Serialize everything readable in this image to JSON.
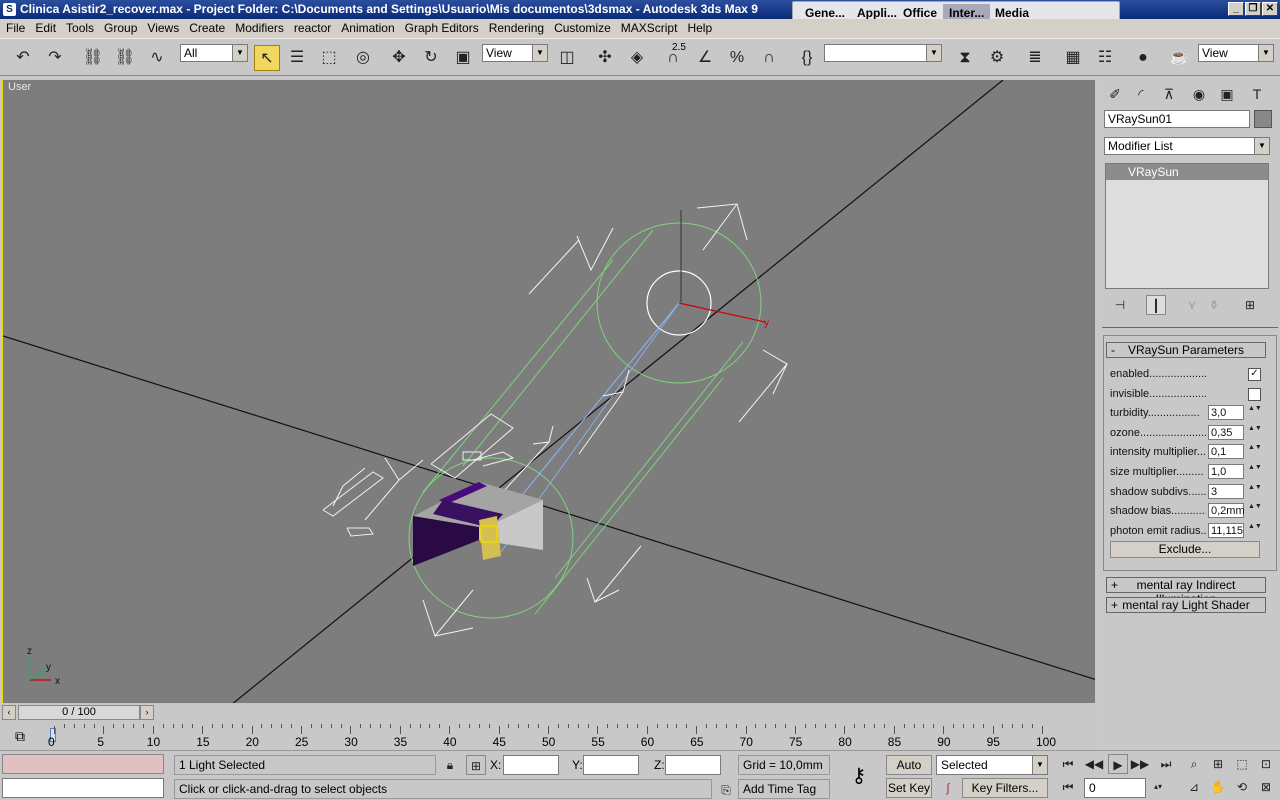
{
  "window": {
    "title": "Clinica Asistir2_recover.max    - Project Folder: C:\\Documents and Settings\\Usuario\\Mis documentos\\3dsmax    - Autodesk 3ds Max 9",
    "tabs": [
      "Gene...",
      "Appli...",
      "Office",
      "Inter...",
      "Media"
    ]
  },
  "menu": [
    "File",
    "Edit",
    "Tools",
    "Group",
    "Views",
    "Create",
    "Modifiers",
    "reactor",
    "Animation",
    "Graph Editors",
    "Rendering",
    "Customize",
    "MAXScript",
    "Help"
  ],
  "toolbar": {
    "selection_filter": "All",
    "ref_coord": "View",
    "snap_value": "2.5",
    "named_sel": "",
    "render_dd": "View"
  },
  "viewport": {
    "label": "User",
    "bg": "#7d7d7d",
    "active_border": "#f0d800"
  },
  "command_panel": {
    "object_name": "VRaySun01",
    "modifier_list": "Modifier List",
    "stack_item": "VRaySun",
    "rollout_title": "VRaySun Parameters",
    "rollout_toggle": "-",
    "params": [
      {
        "label": "enabled...............................",
        "type": "check",
        "value": "✓"
      },
      {
        "label": "invisible............................",
        "type": "check",
        "value": ""
      },
      {
        "label": "turbidity.................",
        "type": "spin",
        "value": "3,0"
      },
      {
        "label": "ozone.......................",
        "type": "spin",
        "value": "0,35"
      },
      {
        "label": "intensity multiplier....",
        "type": "spin",
        "value": "0,1"
      },
      {
        "label": "size multiplier.........",
        "type": "spin",
        "value": "1,0"
      },
      {
        "label": "shadow subdivs.......",
        "type": "spin",
        "value": "3"
      },
      {
        "label": "shadow bias............",
        "type": "spin",
        "value": "0,2mm"
      },
      {
        "label": "photon emit radius...",
        "type": "spin",
        "value": "11,115"
      }
    ],
    "exclude_label": "Exclude...",
    "rollout2": {
      "toggle": "+",
      "title": "mental ray Indirect Illumination"
    },
    "rollout3": {
      "toggle": "+",
      "title": "mental ray Light Shader"
    }
  },
  "timeline": {
    "frame_counter": "0 / 100",
    "ticks": [
      "0",
      "5",
      "10",
      "15",
      "20",
      "25",
      "30",
      "35",
      "40",
      "45",
      "50",
      "55",
      "60",
      "65",
      "70",
      "75",
      "80",
      "85",
      "90",
      "95",
      "100"
    ]
  },
  "status": {
    "selection_info": "1 Light Selected",
    "prompt": "Click or click-and-drag to select objects",
    "x_label": "X:",
    "y_label": "Y:",
    "z_label": "Z:",
    "x_value": "",
    "y_value": "",
    "z_value": "",
    "grid": "Grid = 10,0mm",
    "add_time_tag": "Add Time Tag",
    "auto_key": "Auto Key",
    "set_key": "Set Key",
    "key_mode": "Selected",
    "key_filters": "Key Filters...",
    "current_frame": "0"
  }
}
